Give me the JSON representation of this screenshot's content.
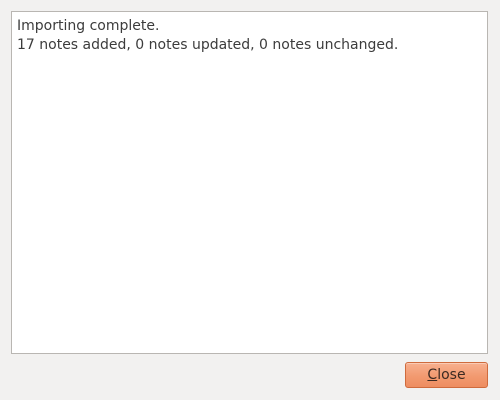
{
  "dialog": {
    "message": {
      "line1": "Importing complete.",
      "line2": "17 notes added, 0 notes updated, 0 notes unchanged."
    },
    "buttons": {
      "close": {
        "mnemonic": "C",
        "rest": "lose"
      }
    }
  },
  "colors": {
    "background": "#f2f1f0",
    "panel": "#ffffff",
    "accent": "#f29a70"
  }
}
